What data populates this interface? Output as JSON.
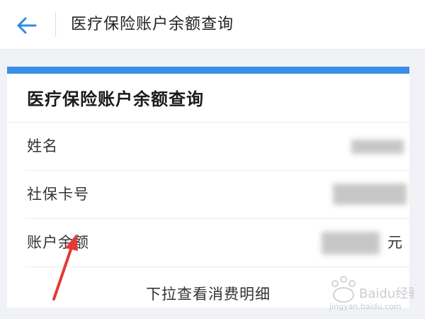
{
  "header": {
    "back_icon": "arrow-left-icon",
    "title": "医疗保险账户余额查询"
  },
  "card": {
    "accent_color": "#3a8ee6",
    "title": "医疗保险账户余额查询",
    "rows": [
      {
        "label": "姓名",
        "value": ""
      },
      {
        "label": "社保卡号",
        "value": ""
      },
      {
        "label": "账户余额",
        "value": "",
        "unit": "元"
      }
    ],
    "footer_link": "下拉查看消费明细"
  },
  "annotation": {
    "arrow_color": "#e53935"
  },
  "watermark": {
    "brand": "Baidu经验",
    "url": "jingyan.baidu.com"
  }
}
